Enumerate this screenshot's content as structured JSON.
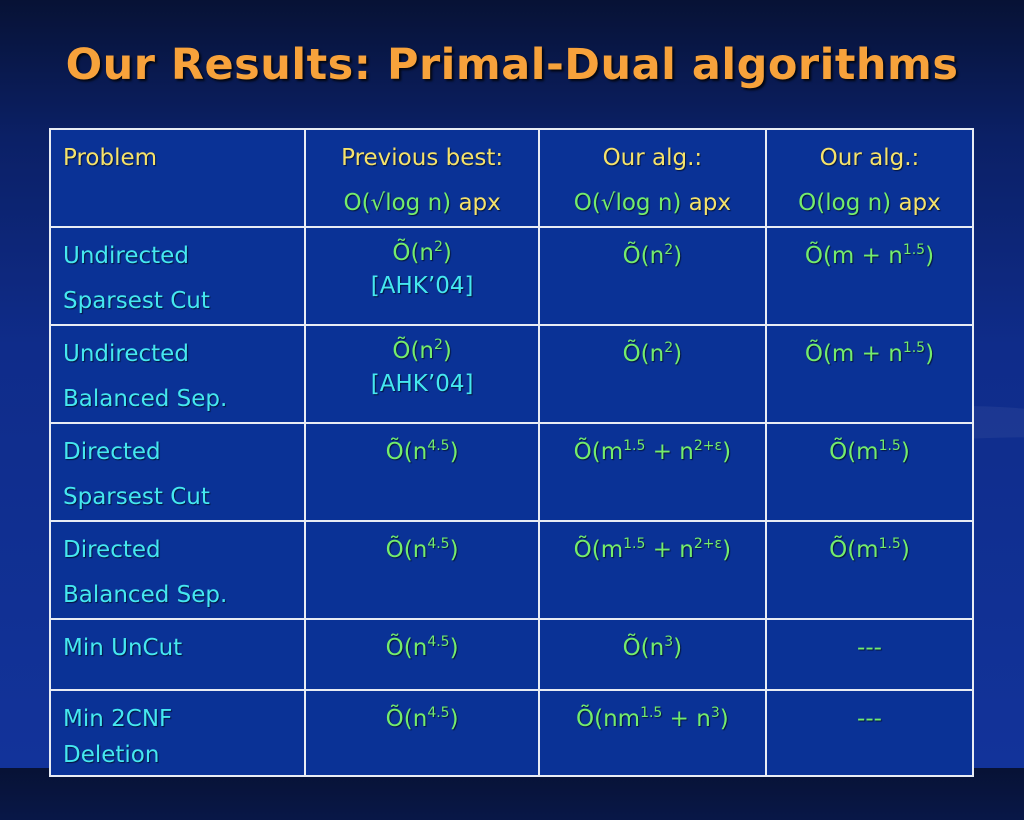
{
  "slide": {
    "title": "Our Results: Primal-Dual algorithms",
    "colors": {
      "title": "#f7a23b",
      "header": "#f5e26b",
      "problem": "#45e8f0",
      "complexity": "#74ec6c",
      "background": "#0f2c8a"
    }
  },
  "table": {
    "headers": [
      {
        "line1": "Problem",
        "line2": ""
      },
      {
        "line1": "Previous best:",
        "line2_green": "O(√log n)",
        "line2_yellow": " apx"
      },
      {
        "line1": "Our alg.:",
        "line2_green": "O(√log n)",
        "line2_yellow": " apx"
      },
      {
        "line1": "Our alg.:",
        "line2_green": "O(log n)",
        "line2_yellow": " apx"
      }
    ],
    "rows": [
      {
        "problem": [
          "Undirected",
          "Sparsest Cut"
        ],
        "prev": {
          "base": "Õ(n",
          "sup": "2",
          "tail": ")",
          "cite": "[AHK’04]"
        },
        "ours_sqrt": {
          "base": "Õ(n",
          "sup": "2",
          "tail": ")"
        },
        "ours_log": {
          "base": "Õ(m + n",
          "sup": "1.5",
          "tail": ")"
        }
      },
      {
        "problem": [
          "Undirected",
          "Balanced Sep."
        ],
        "prev": {
          "base": "Õ(n",
          "sup": "2",
          "tail": ")",
          "cite": "[AHK’04]"
        },
        "ours_sqrt": {
          "base": "Õ(n",
          "sup": "2",
          "tail": ")"
        },
        "ours_log": {
          "base": "Õ(m + n",
          "sup": "1.5",
          "tail": ")"
        }
      },
      {
        "problem": [
          "Directed",
          "Sparsest Cut"
        ],
        "prev": {
          "base": "Õ(n",
          "sup": "4.5",
          "tail": ")"
        },
        "ours_sqrt": {
          "base": "Õ(m",
          "sup": "1.5",
          "mid": " + n",
          "sup2": "2+ε",
          "tail": ")"
        },
        "ours_log": {
          "base": "Õ(m",
          "sup": "1.5",
          "tail": ")"
        }
      },
      {
        "problem": [
          "Directed",
          "Balanced Sep."
        ],
        "prev": {
          "base": "Õ(n",
          "sup": "4.5",
          "tail": ")"
        },
        "ours_sqrt": {
          "base": "Õ(m",
          "sup": "1.5",
          "mid": " + n",
          "sup2": "2+ε",
          "tail": ")"
        },
        "ours_log": {
          "base": "Õ(m",
          "sup": "1.5",
          "tail": ")"
        }
      },
      {
        "problem": [
          "Min UnCut",
          ""
        ],
        "prev": {
          "base": "Õ(n",
          "sup": "4.5",
          "tail": ")"
        },
        "ours_sqrt": {
          "base": "Õ(n",
          "sup": "3",
          "tail": ")"
        },
        "ours_log": {
          "text": "---"
        }
      },
      {
        "problem": [
          "Min 2CNF",
          "Deletion"
        ],
        "prev": {
          "base": "Õ(n",
          "sup": "4.5",
          "tail": ")"
        },
        "ours_sqrt": {
          "base": "Õ(nm",
          "sup": "1.5",
          "mid": " + n",
          "sup2": "3",
          "tail": ")"
        },
        "ours_log": {
          "text": "---"
        }
      }
    ]
  }
}
